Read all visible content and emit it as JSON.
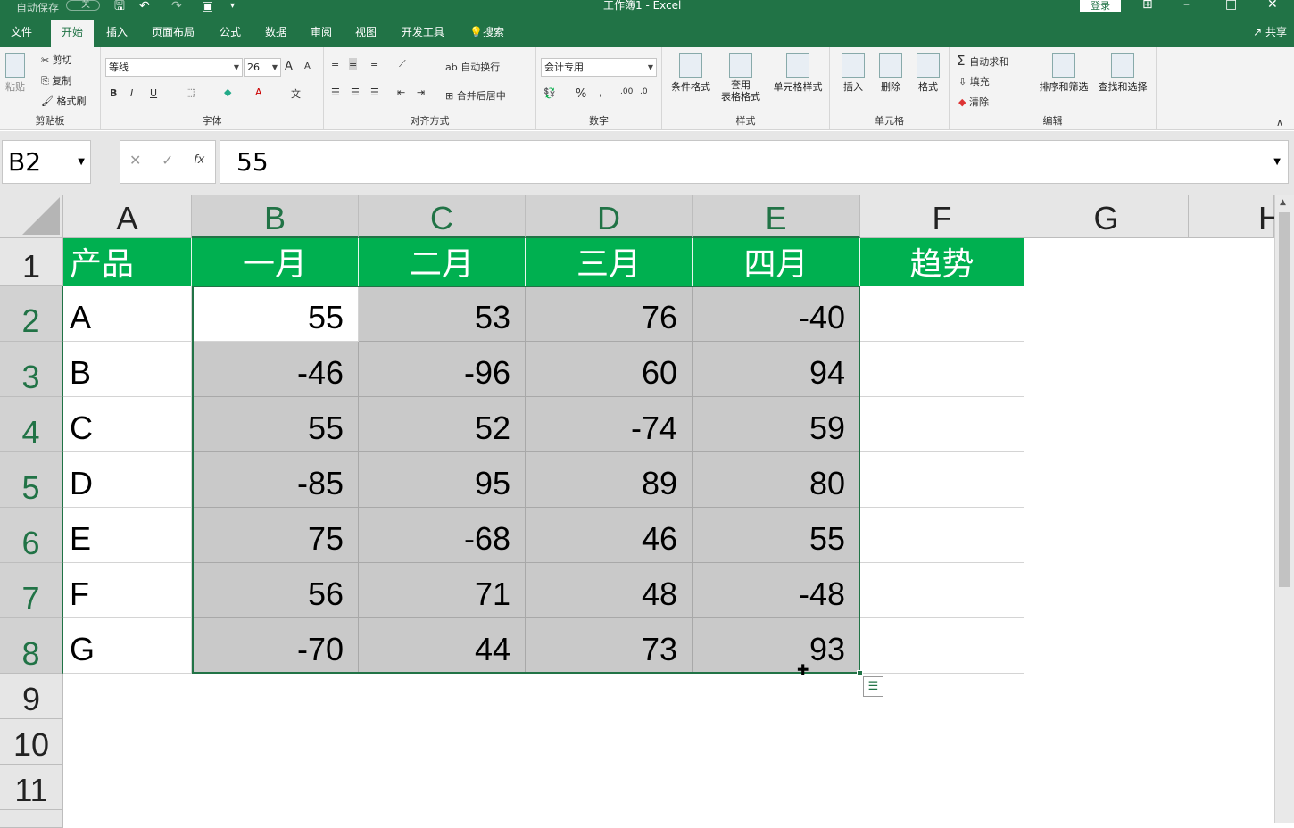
{
  "title_bar": {
    "autosave": "自动保存",
    "autosave_state": "关",
    "window_title": "工作簿1 - Excel",
    "login": "登录"
  },
  "tabs": [
    "文件",
    "开始",
    "插入",
    "页面布局",
    "公式",
    "数据",
    "审阅",
    "视图",
    "开发工具",
    "搜索"
  ],
  "active_tab": "开始",
  "share_label": "共享",
  "ribbon": {
    "clipboard": {
      "paste": "粘贴",
      "cut": "剪切",
      "copy": "复制",
      "format_painter": "格式刷",
      "label": "剪贴板"
    },
    "font": {
      "name": "等线",
      "size": "26",
      "label": "字体",
      "bold": "B",
      "italic": "I",
      "underline": "U",
      "grow": "A",
      "shrink": "A"
    },
    "alignment": {
      "wrap": "自动换行",
      "merge": "合并后居中",
      "label": "对齐方式"
    },
    "number": {
      "format": "会计专用",
      "percent": "%",
      "comma": ",",
      "label": "数字"
    },
    "styles": {
      "conditional": "条件格式",
      "table_format": "套用\n表格格式",
      "cell_styles": "单元格样式",
      "label": "样式"
    },
    "cells": {
      "insert": "插入",
      "delete": "删除",
      "format": "格式",
      "label": "单元格"
    },
    "editing": {
      "autosum": "自动求和",
      "fill": "填充",
      "clear": "清除",
      "sort": "排序和筛选",
      "find": "查找和选择",
      "label": "编辑"
    }
  },
  "formula_bar": {
    "name_box": "B2",
    "fx": "fx",
    "value": "55"
  },
  "columns": [
    "A",
    "B",
    "C",
    "D",
    "E",
    "F",
    "G",
    "H"
  ],
  "rows": [
    "1",
    "2",
    "3",
    "4",
    "5",
    "6",
    "7",
    "8",
    "9",
    "10",
    "11"
  ],
  "table": {
    "headers": [
      "产品",
      "一月",
      "二月",
      "三月",
      "四月",
      "趋势"
    ],
    "data": [
      [
        "A",
        "55",
        "53",
        "76",
        "-40"
      ],
      [
        "B",
        "-46",
        "-96",
        "60",
        "94"
      ],
      [
        "C",
        "55",
        "52",
        "-74",
        "59"
      ],
      [
        "D",
        "-85",
        "95",
        "89",
        "80"
      ],
      [
        "E",
        "75",
        "-68",
        "46",
        "55"
      ],
      [
        "F",
        "56",
        "71",
        "48",
        "-48"
      ],
      [
        "G",
        "-70",
        "44",
        "73",
        "93"
      ]
    ]
  },
  "colors": {
    "excel_green": "#217346",
    "header_fill": "#00b050",
    "selection_fill": "#c9c9c9"
  }
}
